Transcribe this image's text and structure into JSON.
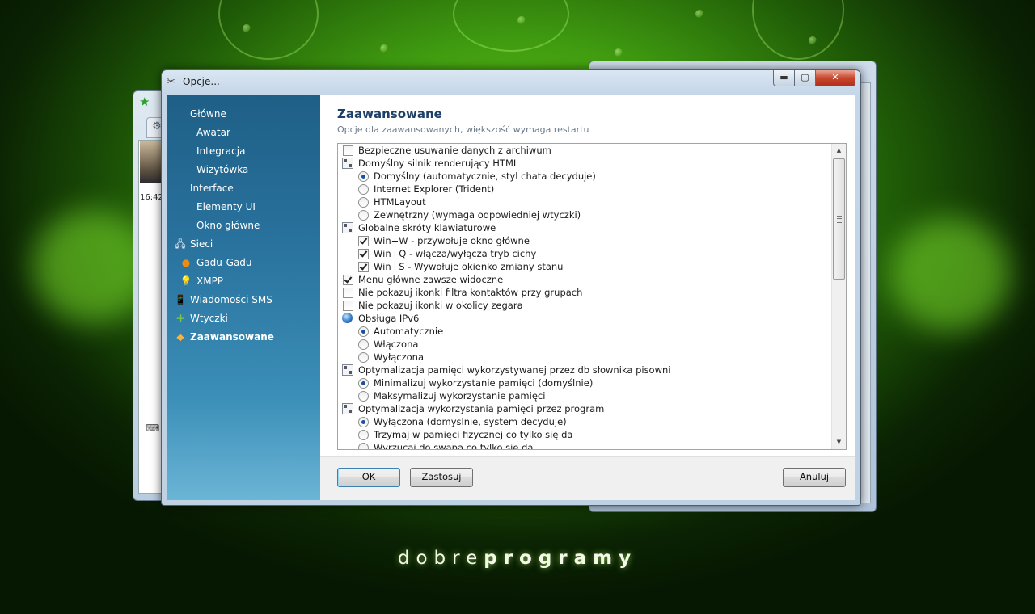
{
  "brand": {
    "part1": "dobre",
    "part2": "programy"
  },
  "background_left_window": {
    "time": "16:42"
  },
  "dialog": {
    "title": "Opcje...",
    "controls": {
      "minimize": "▬",
      "maximize": "▢",
      "close": "✕"
    }
  },
  "sidebar": {
    "items": [
      {
        "label": "Główne",
        "level": 0,
        "icon": null
      },
      {
        "label": "Awatar",
        "level": 1,
        "icon": null
      },
      {
        "label": "Integracja",
        "level": 1,
        "icon": null
      },
      {
        "label": "Wizytówka",
        "level": 1,
        "icon": null
      },
      {
        "label": "Interface",
        "level": 0,
        "icon": null
      },
      {
        "label": "Elementy UI",
        "level": 1,
        "icon": null
      },
      {
        "label": "Okno główne",
        "level": 1,
        "icon": null
      },
      {
        "label": "Sieci",
        "level": 0,
        "icon": "network-icon"
      },
      {
        "label": "Gadu-Gadu",
        "level": 1,
        "icon": "gadu-gadu-icon"
      },
      {
        "label": "XMPP",
        "level": 1,
        "icon": "xmpp-icon"
      },
      {
        "label": "Wiadomości SMS",
        "level": 0,
        "icon": "phone-icon"
      },
      {
        "label": "Wtyczki",
        "level": 0,
        "icon": "puzzle-icon"
      },
      {
        "label": "Zaawansowane",
        "level": 0,
        "icon": "advanced-icon",
        "active": true
      }
    ]
  },
  "content": {
    "heading": "Zaawansowane",
    "subheading": "Opcje dla zaawansowanych, większość wymaga restartu",
    "options": [
      {
        "type": "checkbox",
        "indent": 0,
        "checked": false,
        "label": "Bezpieczne usuwanie danych z archiwum"
      },
      {
        "type": "group",
        "indent": 0,
        "label": "Domyślny silnik renderujący HTML"
      },
      {
        "type": "radio",
        "indent": 1,
        "checked": true,
        "label": "Domyślny (automatycznie, styl chata decyduje)"
      },
      {
        "type": "radio",
        "indent": 1,
        "checked": false,
        "label": "Internet Explorer (Trident)"
      },
      {
        "type": "radio",
        "indent": 1,
        "checked": false,
        "label": "HTMLayout"
      },
      {
        "type": "radio",
        "indent": 1,
        "checked": false,
        "label": "Zewnętrzny (wymaga odpowiedniej wtyczki)"
      },
      {
        "type": "group",
        "indent": 0,
        "label": "Globalne skróty klawiaturowe"
      },
      {
        "type": "checkbox",
        "indent": 1,
        "checked": true,
        "label": "Win+W - przywołuje okno główne"
      },
      {
        "type": "checkbox",
        "indent": 1,
        "checked": true,
        "label": "Win+Q - włącza/wyłącza tryb cichy"
      },
      {
        "type": "checkbox",
        "indent": 1,
        "checked": true,
        "label": "Win+S - Wywołuje okienko zmiany stanu"
      },
      {
        "type": "checkbox",
        "indent": 0,
        "checked": true,
        "label": "Menu główne zawsze widoczne"
      },
      {
        "type": "checkbox",
        "indent": 0,
        "checked": false,
        "label": "Nie pokazuj ikonki filtra kontaktów przy grupach"
      },
      {
        "type": "checkbox",
        "indent": 0,
        "checked": false,
        "label": "Nie pokazuj ikonki w okolicy zegara"
      },
      {
        "type": "globe",
        "indent": 0,
        "label": "Obsługa IPv6"
      },
      {
        "type": "radio",
        "indent": 1,
        "checked": true,
        "label": "Automatycznie"
      },
      {
        "type": "radio",
        "indent": 1,
        "checked": false,
        "label": "Włączona"
      },
      {
        "type": "radio",
        "indent": 1,
        "checked": false,
        "label": "Wyłączona"
      },
      {
        "type": "group",
        "indent": 0,
        "label": "Optymalizacja pamięci wykorzystywanej przez db słownika pisowni"
      },
      {
        "type": "radio",
        "indent": 1,
        "checked": true,
        "label": "Minimalizuj wykorzystanie pamięci (domyślnie)"
      },
      {
        "type": "radio",
        "indent": 1,
        "checked": false,
        "label": "Maksymalizuj wykorzystanie pamięci"
      },
      {
        "type": "group",
        "indent": 0,
        "label": "Optymalizacja wykorzystania pamięci przez program"
      },
      {
        "type": "radio",
        "indent": 1,
        "checked": true,
        "label": "Wyłączona (domyslnie, system decyduje)"
      },
      {
        "type": "radio",
        "indent": 1,
        "checked": false,
        "label": "Trzymaj w pamięci fizycznej co tylko się da"
      },
      {
        "type": "radio",
        "indent": 1,
        "checked": false,
        "label": "Wyrzucaj do swapa co tylko się da"
      }
    ]
  },
  "buttons": {
    "ok": "OK",
    "apply": "Zastosuj",
    "cancel": "Anuluj"
  },
  "colors": {
    "sidebar": "#2a74a0",
    "heading": "#1e3f66",
    "background": "#3f9a10"
  }
}
